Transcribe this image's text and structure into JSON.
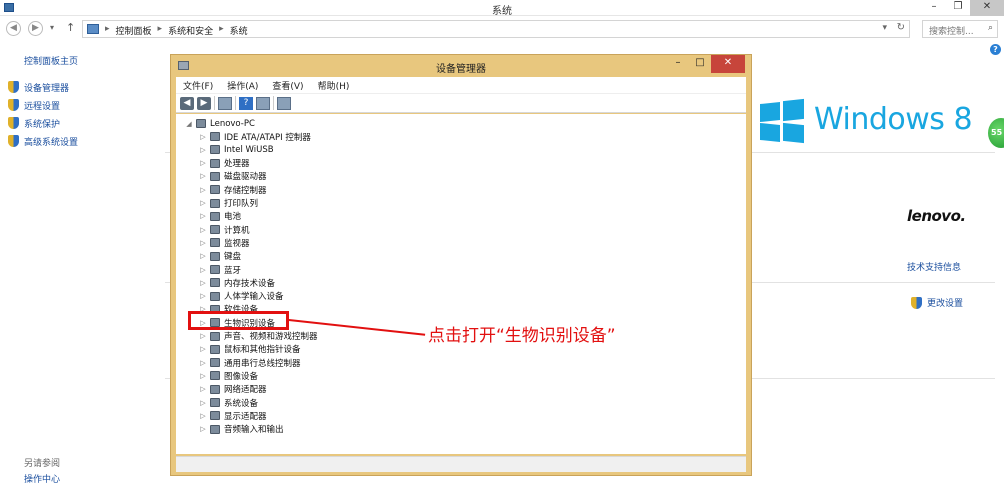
{
  "window": {
    "title": "系统",
    "controls": {
      "minimize": "–",
      "restore": "❐",
      "close": "✕"
    }
  },
  "address": {
    "crumbs": [
      "控制面板",
      "系统和安全",
      "系统"
    ],
    "separator": "▸",
    "search_placeholder": "搜索控制...",
    "search_icon": "magnifier-icon"
  },
  "help_label": "?",
  "left": {
    "home": "控制面板主页",
    "items": [
      {
        "label": "设备管理器",
        "icon": "shield-icon"
      },
      {
        "label": "远程设置",
        "icon": "shield-icon"
      },
      {
        "label": "系统保护",
        "icon": "shield-icon"
      },
      {
        "label": "高级系统设置",
        "icon": "shield-icon"
      }
    ],
    "see_also": "另请参阅",
    "action_center": "操作中心"
  },
  "right": {
    "brand": "Windows 8",
    "oem": "lenovo.",
    "support": "技术支持信息",
    "change_settings": "更改设置",
    "badge": "55",
    "accent": "#19a6e0"
  },
  "device_manager": {
    "title": "设备管理器",
    "controls": {
      "minimize": "–",
      "restore": "□",
      "close": "✕"
    },
    "menu": [
      "文件(F)",
      "操作(A)",
      "查看(V)",
      "帮助(H)"
    ],
    "toolbar": {
      "back": "◀",
      "forward": "▶",
      "help": "?"
    },
    "root": "Lenovo-PC",
    "categories": [
      "IDE ATA/ATAPI 控制器",
      "Intel WiUSB",
      "处理器",
      "磁盘驱动器",
      "存储控制器",
      "打印队列",
      "电池",
      "计算机",
      "监视器",
      "键盘",
      "蓝牙",
      "内存技术设备",
      "人体学输入设备",
      "软件设备",
      "生物识别设备",
      "声音、视频和游戏控制器",
      "鼠标和其他指针设备",
      "通用串行总线控制器",
      "图像设备",
      "网络适配器",
      "系统设备",
      "显示适配器",
      "音频输入和输出"
    ],
    "highlighted": "生物识别设备"
  },
  "annotation": {
    "text": "点击打开“生物识别设备”",
    "color": "#e21010"
  }
}
